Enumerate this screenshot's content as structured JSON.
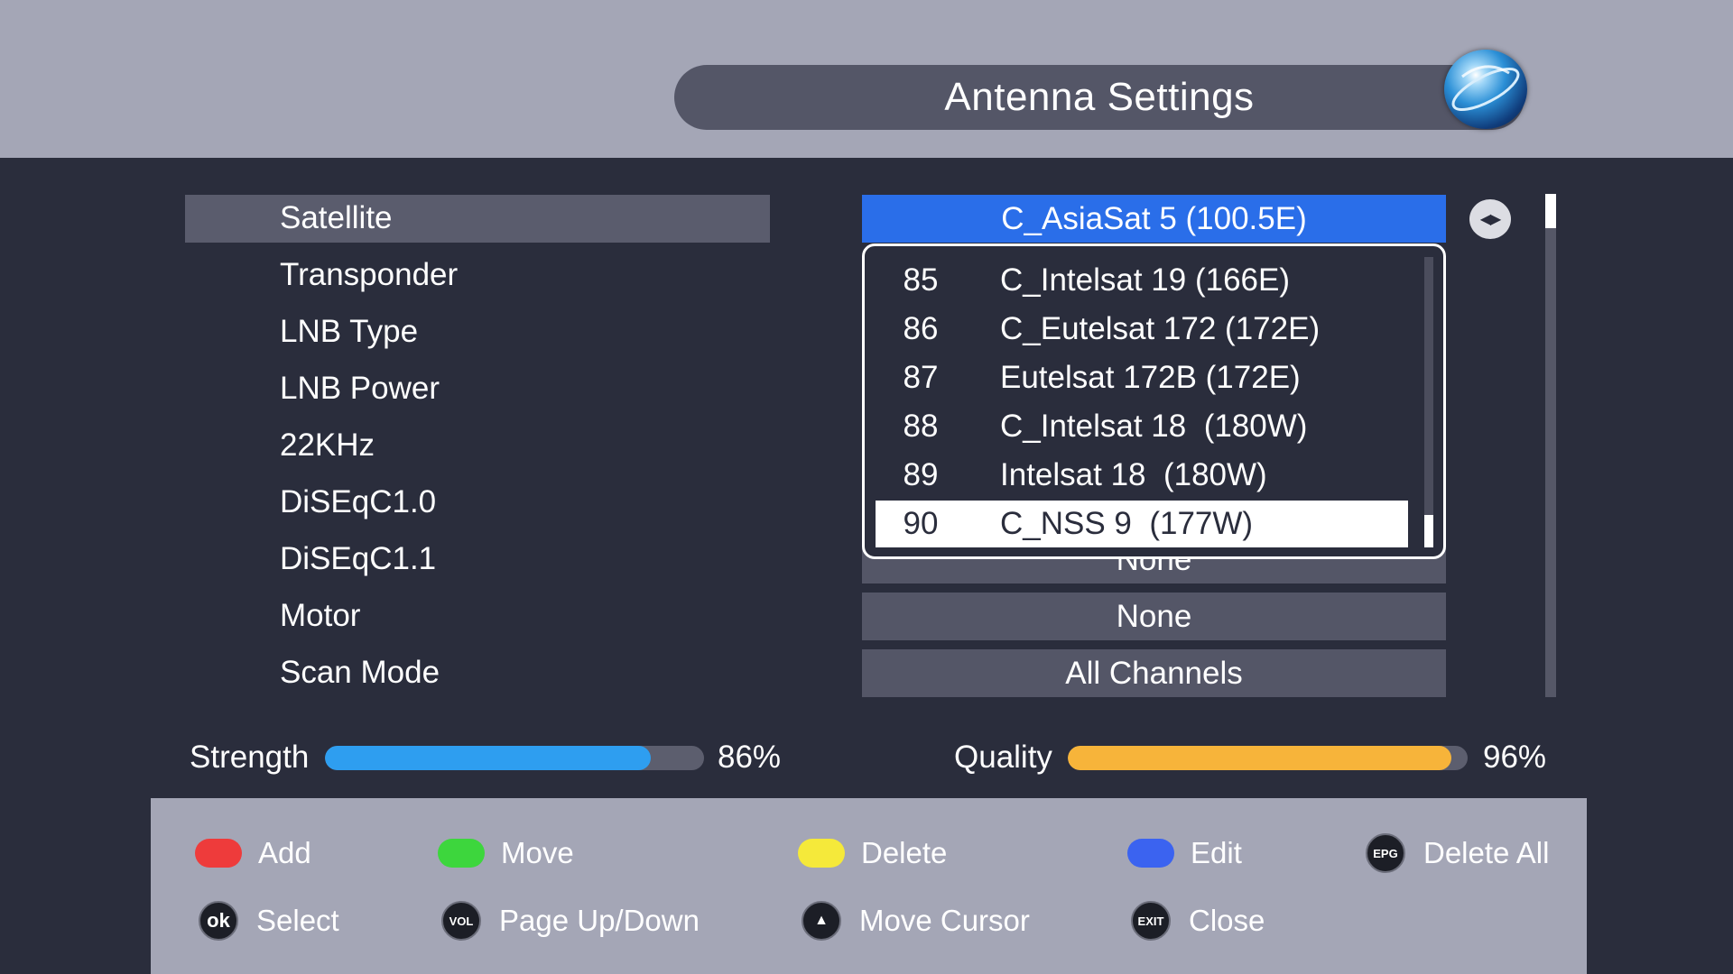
{
  "header": {
    "title": "Antenna Settings",
    "logo_icon": "globe-icon"
  },
  "menu": {
    "items": [
      {
        "label": "Satellite"
      },
      {
        "label": "Transponder"
      },
      {
        "label": "LNB Type"
      },
      {
        "label": "LNB Power"
      },
      {
        "label": "22KHz"
      },
      {
        "label": "DiSEqC1.0"
      },
      {
        "label": "DiSEqC1.1"
      },
      {
        "label": "Motor"
      },
      {
        "label": "Scan Mode"
      }
    ],
    "selected_index": 0
  },
  "values": {
    "satellite": "C_AsiaSat 5 (100.5E)",
    "diseqc11_partial": "None",
    "motor": "None",
    "scan_mode": "All Channels"
  },
  "satellite_list": {
    "rows": [
      {
        "num": "85",
        "name": "C_Intelsat 19 (166E)"
      },
      {
        "num": "86",
        "name": "C_Eutelsat 172 (172E)"
      },
      {
        "num": "87",
        "name": "Eutelsat 172B (172E)"
      },
      {
        "num": "88",
        "name": "C_Intelsat 18  (180W)"
      },
      {
        "num": "89",
        "name": "Intelsat 18  (180W)"
      },
      {
        "num": "90",
        "name": "C_NSS 9  (177W)"
      }
    ],
    "selected_index": 5
  },
  "signal": {
    "strength_label": "Strength",
    "strength_value": "86%",
    "strength_fraction": 0.86,
    "quality_label": "Quality",
    "quality_value": "96%",
    "quality_fraction": 0.96
  },
  "help": {
    "add": "Add",
    "move": "Move",
    "delete": "Delete",
    "edit": "Edit",
    "delete_all": "Delete All",
    "select": "Select",
    "page_updown": "Page Up/Down",
    "move_cursor": "Move Cursor",
    "close": "Close",
    "epg_badge": "EPG",
    "ok_badge": "ok",
    "vol_badge": "VOL",
    "exit_badge": "EXIT"
  },
  "colors": {
    "red": "#ee3b3b",
    "green": "#3dd63d",
    "yellow": "#f5e93a",
    "blue": "#3b63f0",
    "strength_fill": "#2e9ef0",
    "quality_fill": "#f7b43a",
    "active_value": "#2a6ee9"
  }
}
